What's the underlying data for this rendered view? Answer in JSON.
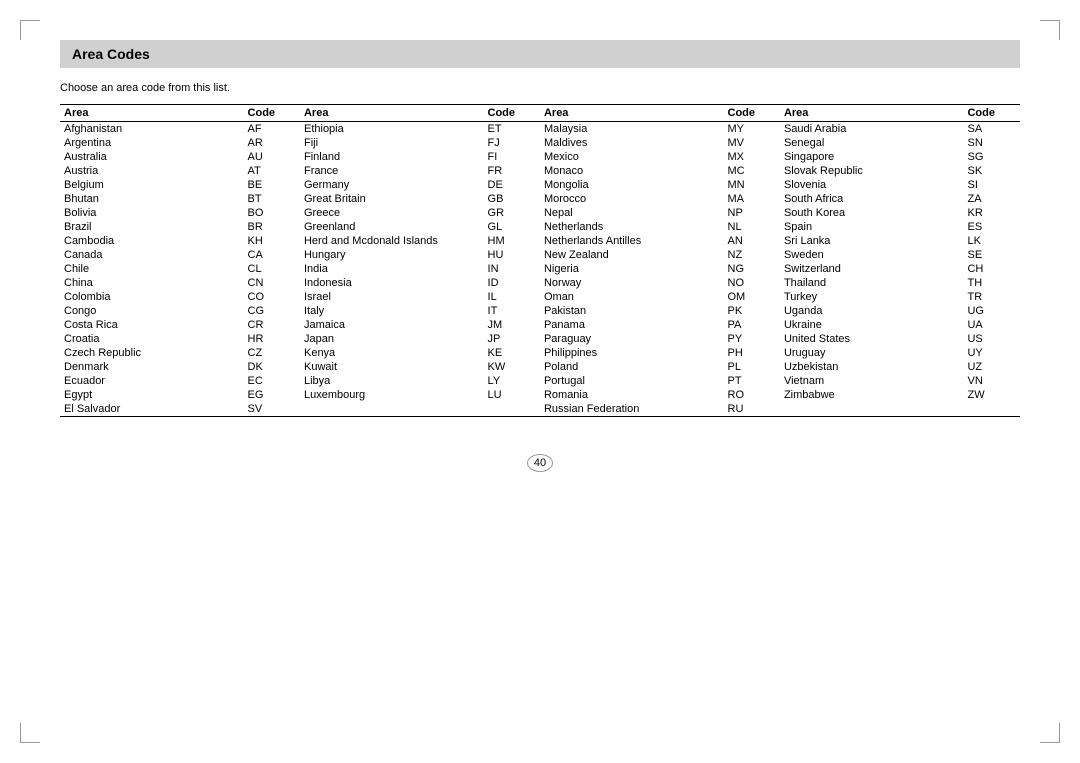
{
  "title": "Area Codes",
  "subtitle": "Choose an area code from this list.",
  "page_number": "40",
  "columns": [
    {
      "area_header": "Area",
      "code_header": "Code"
    },
    {
      "area_header": "Area",
      "code_header": "Code"
    },
    {
      "area_header": "Area",
      "code_header": "Code"
    },
    {
      "area_header": "Area",
      "code_header": "Code"
    }
  ],
  "col1": [
    {
      "area": "Afghanistan",
      "code": "AF"
    },
    {
      "area": "Argentina",
      "code": "AR"
    },
    {
      "area": "Australia",
      "code": "AU"
    },
    {
      "area": "Austria",
      "code": "AT"
    },
    {
      "area": "Belgium",
      "code": "BE"
    },
    {
      "area": "Bhutan",
      "code": "BT"
    },
    {
      "area": "Bolivia",
      "code": "BO"
    },
    {
      "area": "Brazil",
      "code": "BR"
    },
    {
      "area": "Cambodia",
      "code": "KH"
    },
    {
      "area": "Canada",
      "code": "CA"
    },
    {
      "area": "Chile",
      "code": "CL"
    },
    {
      "area": "China",
      "code": "CN"
    },
    {
      "area": "Colombia",
      "code": "CO"
    },
    {
      "area": "Congo",
      "code": "CG"
    },
    {
      "area": "Costa Rica",
      "code": "CR"
    },
    {
      "area": "Croatia",
      "code": "HR"
    },
    {
      "area": "Czech Republic",
      "code": "CZ"
    },
    {
      "area": "Denmark",
      "code": "DK"
    },
    {
      "area": "Ecuador",
      "code": "EC"
    },
    {
      "area": "Egypt",
      "code": "EG"
    },
    {
      "area": "El Salvador",
      "code": "SV"
    }
  ],
  "col2": [
    {
      "area": "Ethiopia",
      "code": "ET"
    },
    {
      "area": "Fiji",
      "code": "FJ"
    },
    {
      "area": "Finland",
      "code": "FI"
    },
    {
      "area": "France",
      "code": "FR"
    },
    {
      "area": "Germany",
      "code": "DE"
    },
    {
      "area": "Great Britain",
      "code": "GB"
    },
    {
      "area": "Greece",
      "code": "GR"
    },
    {
      "area": "Greenland",
      "code": "GL"
    },
    {
      "area": "Herd and Mcdonald Islands",
      "code": "HM"
    },
    {
      "area": "Hungary",
      "code": "HU"
    },
    {
      "area": "India",
      "code": "IN"
    },
    {
      "area": "Indonesia",
      "code": "ID"
    },
    {
      "area": "Israel",
      "code": "IL"
    },
    {
      "area": "Italy",
      "code": "IT"
    },
    {
      "area": "Jamaica",
      "code": "JM"
    },
    {
      "area": "Japan",
      "code": "JP"
    },
    {
      "area": "Kenya",
      "code": "KE"
    },
    {
      "area": "Kuwait",
      "code": "KW"
    },
    {
      "area": "Libya",
      "code": "LY"
    },
    {
      "area": "Luxembourg",
      "code": "LU"
    }
  ],
  "col3": [
    {
      "area": "Malaysia",
      "code": "MY"
    },
    {
      "area": "Maldives",
      "code": "MV"
    },
    {
      "area": "Mexico",
      "code": "MX"
    },
    {
      "area": "Monaco",
      "code": "MC"
    },
    {
      "area": "Mongolia",
      "code": "MN"
    },
    {
      "area": "Morocco",
      "code": "MA"
    },
    {
      "area": "Nepal",
      "code": "NP"
    },
    {
      "area": "Netherlands",
      "code": "NL"
    },
    {
      "area": "Netherlands Antilles",
      "code": "AN"
    },
    {
      "area": "New Zealand",
      "code": "NZ"
    },
    {
      "area": "Nigeria",
      "code": "NG"
    },
    {
      "area": "Norway",
      "code": "NO"
    },
    {
      "area": "Oman",
      "code": "OM"
    },
    {
      "area": "Pakistan",
      "code": "PK"
    },
    {
      "area": "Panama",
      "code": "PA"
    },
    {
      "area": "Paraguay",
      "code": "PY"
    },
    {
      "area": "Philippines",
      "code": "PH"
    },
    {
      "area": "Poland",
      "code": "PL"
    },
    {
      "area": "Portugal",
      "code": "PT"
    },
    {
      "area": "Romania",
      "code": "RO"
    },
    {
      "area": "Russian Federation",
      "code": "RU"
    }
  ],
  "col4": [
    {
      "area": "Saudi Arabia",
      "code": "SA"
    },
    {
      "area": "Senegal",
      "code": "SN"
    },
    {
      "area": "Singapore",
      "code": "SG"
    },
    {
      "area": "Slovak Republic",
      "code": "SK"
    },
    {
      "area": "Slovenia",
      "code": "SI"
    },
    {
      "area": "South Africa",
      "code": "ZA"
    },
    {
      "area": "South Korea",
      "code": "KR"
    },
    {
      "area": "Spain",
      "code": "ES"
    },
    {
      "area": "Sri Lanka",
      "code": "LK"
    },
    {
      "area": "Sweden",
      "code": "SE"
    },
    {
      "area": "Switzerland",
      "code": "CH"
    },
    {
      "area": "Thailand",
      "code": "TH"
    },
    {
      "area": "Turkey",
      "code": "TR"
    },
    {
      "area": "Uganda",
      "code": "UG"
    },
    {
      "area": "Ukraine",
      "code": "UA"
    },
    {
      "area": "United States",
      "code": "US"
    },
    {
      "area": "Uruguay",
      "code": "UY"
    },
    {
      "area": "Uzbekistan",
      "code": "UZ"
    },
    {
      "area": "Vietnam",
      "code": "VN"
    },
    {
      "area": "Zimbabwe",
      "code": "ZW"
    }
  ]
}
